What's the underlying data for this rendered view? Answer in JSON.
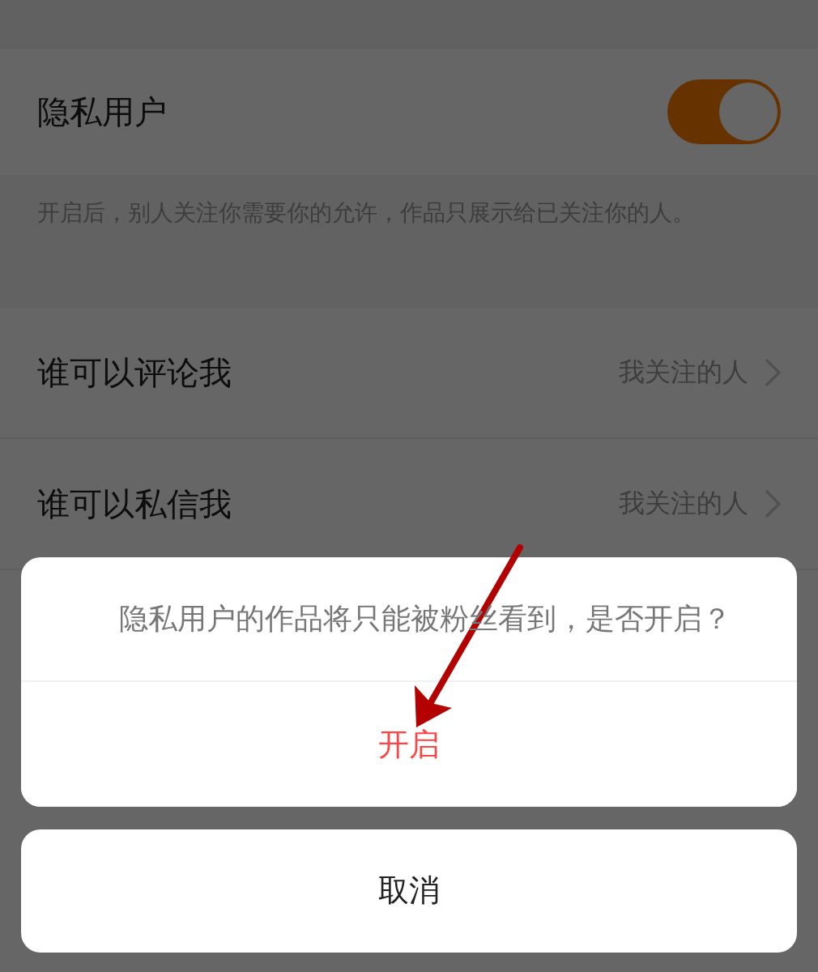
{
  "settings": [
    {
      "kind": "toggle",
      "label": "隐私用户",
      "on": true
    },
    {
      "kind": "note",
      "text": "开启后，别人关注你需要你的允许，作品只展示给已关注你的人。"
    },
    {
      "kind": "value",
      "label": "谁可以评论我",
      "value": "我关注的人"
    },
    {
      "kind": "value",
      "label": "谁可以私信我",
      "value": "我关注的人"
    }
  ],
  "dialog": {
    "message": "隐私用户的作品将只能被粉丝看到，是否开启？",
    "confirm": "开启",
    "cancel": "取消"
  }
}
